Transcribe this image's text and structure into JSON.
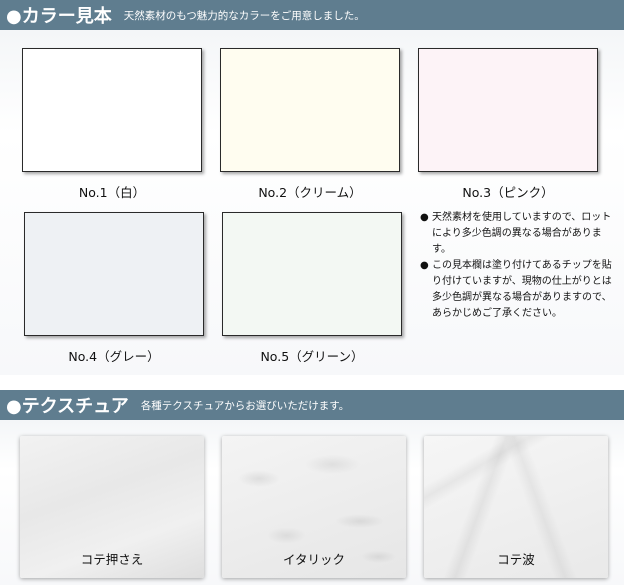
{
  "color_section": {
    "title": "●カラー見本",
    "subtitle": "天然素材のもつ魅力的なカラーをご用意しました。",
    "swatches": [
      {
        "label": "No.1（白）",
        "color": "#ffffff"
      },
      {
        "label": "No.2（クリーム）",
        "color": "#fffdf0"
      },
      {
        "label": "No.3（ピンク）",
        "color": "#fdf3f7"
      },
      {
        "label": "No.4（グレー）",
        "color": "#eef1f4"
      },
      {
        "label": "No.5（グリーン）",
        "color": "#f3f8f3"
      }
    ],
    "notes": [
      {
        "bullet": "●",
        "text": "天然素材を使用していますので、ロットにより多少色調の異なる場合があります。"
      },
      {
        "bullet": "●",
        "text": "この見本欄は塗り付けてあるチップを貼り付けていますが、現物の仕上がりとは多少色調が異なる場合がありますので、あらかじめご了承ください。"
      }
    ]
  },
  "texture_section": {
    "title": "●テクスチュア",
    "subtitle": "各種テクスチュアからお選びいただけます。",
    "textures": [
      {
        "label": "コテ押さえ"
      },
      {
        "label": "イタリック"
      },
      {
        "label": "コテ波"
      }
    ]
  },
  "colors": {
    "band": "#5f7d8f"
  }
}
